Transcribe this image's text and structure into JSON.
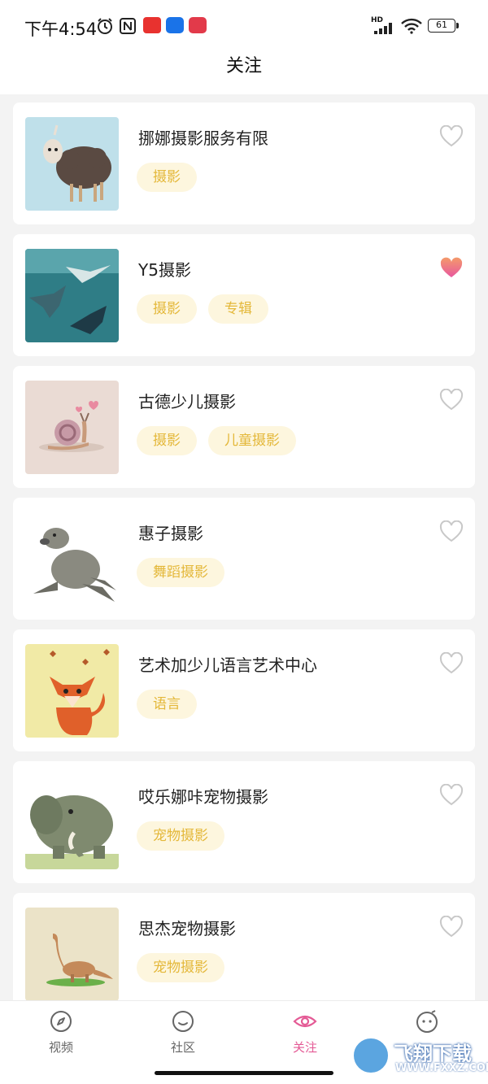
{
  "status_bar": {
    "time": "下午4:54",
    "hd": "HD",
    "battery": "61"
  },
  "header": {
    "title": "关注"
  },
  "colors": {
    "tag_bg": "#fdf6de",
    "tag_text": "#e4b83a",
    "heart_active": "#ec6aa3",
    "tab_active": "#e45a95"
  },
  "items": [
    {
      "name": "挪娜摄影服务有限",
      "tags": [
        "摄影"
      ],
      "liked": false,
      "image": "sheep"
    },
    {
      "name": "Y5摄影",
      "tags": [
        "摄影",
        "专辑"
      ],
      "liked": true,
      "image": "manta-rays"
    },
    {
      "name": "古德少儿摄影",
      "tags": [
        "摄影",
        "儿童摄影"
      ],
      "liked": false,
      "image": "snail"
    },
    {
      "name": "惠子摄影",
      "tags": [
        "舞蹈摄影"
      ],
      "liked": false,
      "image": "sea-lion"
    },
    {
      "name": "艺术加少儿语言艺术中心",
      "tags": [
        "语言"
      ],
      "liked": false,
      "image": "fox"
    },
    {
      "name": "哎乐娜咔宠物摄影",
      "tags": [
        "宠物摄影"
      ],
      "liked": false,
      "image": "elephant"
    },
    {
      "name": "思杰宠物摄影",
      "tags": [
        "宠物摄影"
      ],
      "liked": false,
      "image": "dinosaur"
    }
  ],
  "tabbar": {
    "tabs": [
      {
        "label": "视频",
        "icon": "compass-icon",
        "active": false
      },
      {
        "label": "社区",
        "icon": "smile-icon",
        "active": false
      },
      {
        "label": "关注",
        "icon": "eye-icon",
        "active": true
      },
      {
        "label": "",
        "icon": "face-icon",
        "active": false
      }
    ]
  },
  "watermark": {
    "main": "飞翔下载",
    "sub": "WWW.FXXZ.COM"
  }
}
